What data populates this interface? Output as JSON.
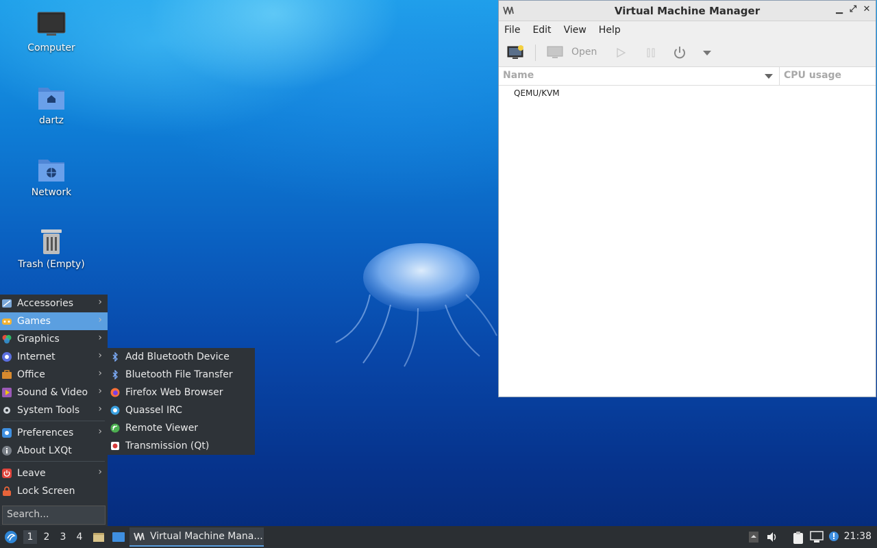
{
  "desktop": {
    "icons": [
      {
        "label": "Computer"
      },
      {
        "label": "dartz"
      },
      {
        "label": "Network"
      },
      {
        "label": "Trash (Empty)"
      }
    ]
  },
  "vmm": {
    "title": "Virtual Machine Manager",
    "menu": [
      "File",
      "Edit",
      "View",
      "Help"
    ],
    "toolbar": {
      "open_label": "Open"
    },
    "columns": [
      "Name",
      "CPU usage"
    ],
    "rows": [
      "QEMU/KVM"
    ]
  },
  "start_menu": {
    "items": [
      {
        "label": "Accessories"
      },
      {
        "label": "Games"
      },
      {
        "label": "Graphics"
      },
      {
        "label": "Internet"
      },
      {
        "label": "Office"
      },
      {
        "label": "Sound & Video"
      },
      {
        "label": "System Tools"
      },
      {
        "label": "Preferences"
      },
      {
        "label": "About LXQt"
      },
      {
        "label": "Leave"
      },
      {
        "label": "Lock Screen"
      }
    ],
    "search_placeholder": "Search...",
    "submenu": [
      {
        "label": "Add Bluetooth Device"
      },
      {
        "label": "Bluetooth File Transfer"
      },
      {
        "label": "Firefox Web Browser"
      },
      {
        "label": "Quassel IRC"
      },
      {
        "label": "Remote Viewer"
      },
      {
        "label": "Transmission (Qt)"
      }
    ]
  },
  "taskbar": {
    "workspaces": [
      "1",
      "2",
      "3",
      "4"
    ],
    "task_label": "Virtual Machine Mana...",
    "clock": "21:38"
  },
  "colors": {
    "accent": "#5b9fe0",
    "panel": "#2e3338"
  }
}
